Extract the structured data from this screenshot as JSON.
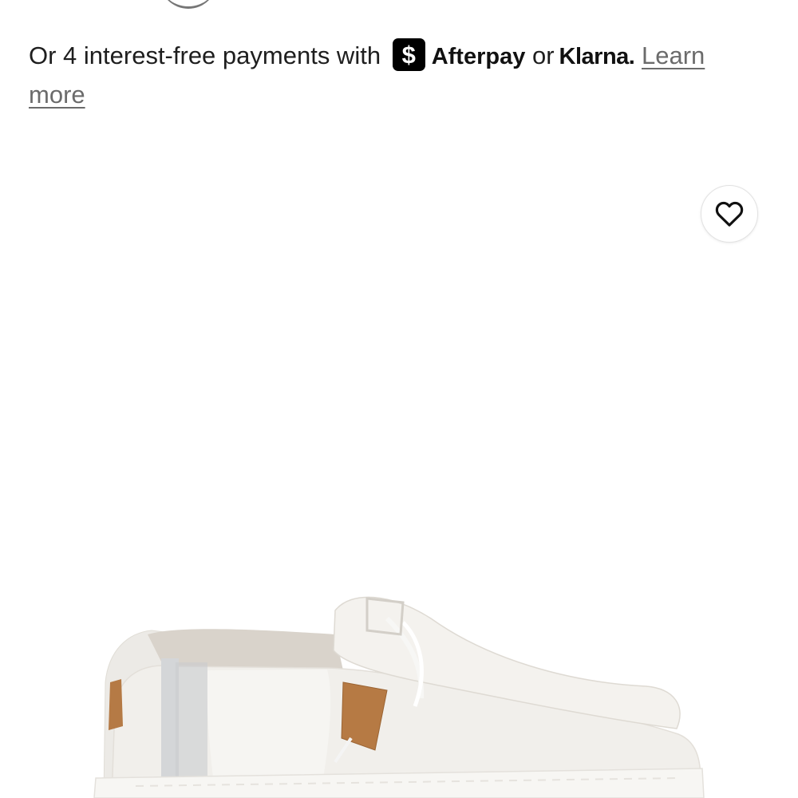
{
  "payment": {
    "prefix": "Or 4 interest-free payments with",
    "afterpay_glyph": "$",
    "afterpay_label": "Afterpay",
    "or_text": "or",
    "klarna_label": "Klarna.",
    "learn_more": "Learn more"
  },
  "wishlist": {
    "icon": "heart-outline-icon"
  },
  "product_image": {
    "subject": "white slip-on canvas shoe with cork lace tips"
  },
  "colors": {
    "afterpay_badge": "#000000",
    "link": "#6b6b6b",
    "text": "#1e1e1e"
  }
}
